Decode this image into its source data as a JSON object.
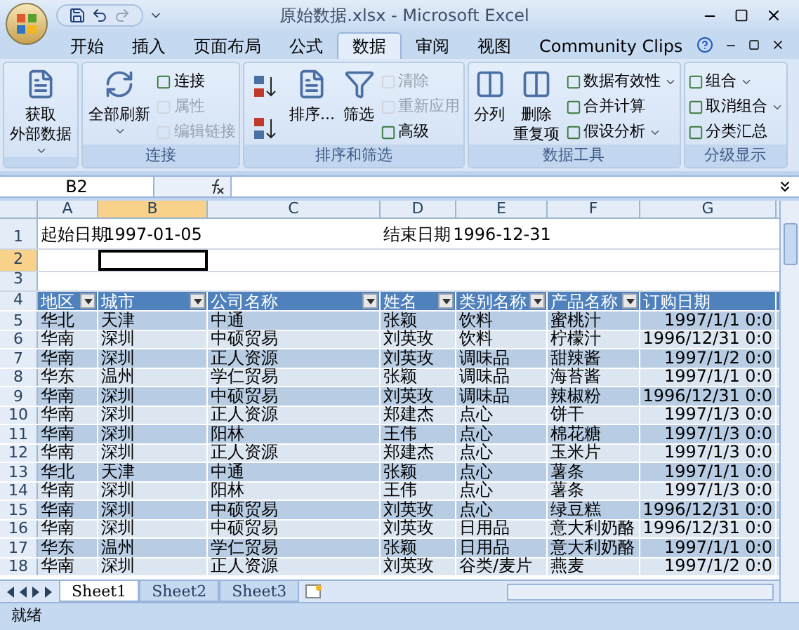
{
  "window": {
    "title": "原始数据.xlsx - Microsoft Excel"
  },
  "tabs": [
    {
      "label": "开始",
      "selected": false
    },
    {
      "label": "插入",
      "selected": false
    },
    {
      "label": "页面布局",
      "selected": false
    },
    {
      "label": "公式",
      "selected": false
    },
    {
      "label": "数据",
      "selected": true
    },
    {
      "label": "审阅",
      "selected": false
    },
    {
      "label": "视图",
      "selected": false
    },
    {
      "label": "Community Clips",
      "selected": false
    }
  ],
  "ribbon": [
    {
      "items": [
        {
          "kind": "large",
          "lines": [
            "获取",
            "外部数据"
          ],
          "dropdown": true,
          "disabled": false
        }
      ]
    },
    {
      "title": "连接",
      "items": [
        {
          "kind": "large",
          "lines": [
            "全部刷新"
          ],
          "dropdown": true,
          "disabled": false
        },
        {
          "kind": "small",
          "label": "连接",
          "dropdown": false,
          "disabled": false
        },
        {
          "kind": "small",
          "label": "属性",
          "dropdown": false,
          "disabled": true
        },
        {
          "kind": "small",
          "label": "编辑链接",
          "dropdown": false,
          "disabled": true
        }
      ]
    },
    {
      "title": "排序和筛选",
      "items": [
        {
          "kind": "sort",
          "dropdown": false,
          "disabled": false
        },
        {
          "kind": "large",
          "lines": [
            "排序..."
          ],
          "dropdown": false,
          "disabled": false
        },
        {
          "kind": "large",
          "lines": [
            "筛选"
          ],
          "dropdown": false,
          "disabled": false
        },
        {
          "kind": "small",
          "label": "清除",
          "dropdown": false,
          "disabled": true
        },
        {
          "kind": "small",
          "label": "重新应用",
          "dropdown": false,
          "disabled": true
        },
        {
          "kind": "small",
          "label": "高级",
          "dropdown": false,
          "disabled": false
        }
      ]
    },
    {
      "title": "数据工具",
      "items": [
        {
          "kind": "large",
          "lines": [
            "分列"
          ],
          "dropdown": false,
          "disabled": false
        },
        {
          "kind": "large",
          "lines": [
            "删除",
            "重复项"
          ],
          "dropdown": false,
          "disabled": false
        },
        {
          "kind": "small",
          "label": "数据有效性",
          "dropdown": true,
          "disabled": false
        },
        {
          "kind": "small",
          "label": "合并计算",
          "dropdown": false,
          "disabled": false
        },
        {
          "kind": "small",
          "label": "假设分析",
          "dropdown": true,
          "disabled": false
        }
      ]
    },
    {
      "title": "分级显示",
      "items": [
        {
          "kind": "small",
          "label": "组合",
          "dropdown": true,
          "disabled": false
        },
        {
          "kind": "small",
          "label": "取消组合",
          "dropdown": true,
          "disabled": false
        },
        {
          "kind": "small",
          "label": "分类汇总",
          "dropdown": false,
          "disabled": false
        }
      ]
    }
  ],
  "name_box": "B2",
  "columns": [
    {
      "label": "A",
      "selected": false
    },
    {
      "label": "B",
      "selected": true
    },
    {
      "label": "C",
      "selected": false
    },
    {
      "label": "D",
      "selected": false
    },
    {
      "label": "E",
      "selected": false
    },
    {
      "label": "F",
      "selected": false
    },
    {
      "label": "G",
      "selected": false
    }
  ],
  "top_rows": [
    {
      "number": "1",
      "selected": false,
      "cells": [
        "起始日期",
        "1997-01-05",
        "",
        "结束日期",
        "1996-12-31",
        "",
        ""
      ]
    },
    {
      "number": "2",
      "selected": true,
      "cells": [
        "",
        "",
        "",
        "",
        "",
        "",
        ""
      ]
    },
    {
      "number": "3",
      "selected": false,
      "cells": [
        "",
        "",
        "",
        "",
        "",
        "",
        ""
      ]
    }
  ],
  "table": {
    "row_number": "4",
    "columns": [
      "地区",
      "城市",
      "公司名称",
      "姓名",
      "类别名称",
      "产品名称",
      "订购日期"
    ],
    "rows": [
      {
        "number": "5",
        "cells": [
          "华北",
          "天津",
          "中通",
          "张颖",
          "饮料",
          "蜜桃汁",
          "1997/1/1 0:0"
        ]
      },
      {
        "number": "6",
        "cells": [
          "华南",
          "深圳",
          "中硕贸易",
          "刘英玫",
          "饮料",
          "柠檬汁",
          "1996/12/31 0:0"
        ]
      },
      {
        "number": "7",
        "cells": [
          "华南",
          "深圳",
          "正人资源",
          "刘英玫",
          "调味品",
          "甜辣酱",
          "1997/1/2 0:0"
        ]
      },
      {
        "number": "8",
        "cells": [
          "华东",
          "温州",
          "学仁贸易",
          "张颖",
          "调味品",
          "海苔酱",
          "1997/1/1 0:0"
        ]
      },
      {
        "number": "9",
        "cells": [
          "华南",
          "深圳",
          "中硕贸易",
          "刘英玫",
          "调味品",
          "辣椒粉",
          "1996/12/31 0:0"
        ]
      },
      {
        "number": "10",
        "cells": [
          "华南",
          "深圳",
          "正人资源",
          "郑建杰",
          "点心",
          "饼干",
          "1997/1/3 0:0"
        ]
      },
      {
        "number": "11",
        "cells": [
          "华南",
          "深圳",
          "阳林",
          "王伟",
          "点心",
          "棉花糖",
          "1997/1/3 0:0"
        ]
      },
      {
        "number": "12",
        "cells": [
          "华南",
          "深圳",
          "正人资源",
          "郑建杰",
          "点心",
          "玉米片",
          "1997/1/3 0:0"
        ]
      },
      {
        "number": "13",
        "cells": [
          "华北",
          "天津",
          "中通",
          "张颖",
          "点心",
          "薯条",
          "1997/1/1 0:0"
        ]
      },
      {
        "number": "14",
        "cells": [
          "华南",
          "深圳",
          "阳林",
          "王伟",
          "点心",
          "薯条",
          "1997/1/3 0:0"
        ]
      },
      {
        "number": "15",
        "cells": [
          "华南",
          "深圳",
          "中硕贸易",
          "刘英玫",
          "点心",
          "绿豆糕",
          "1996/12/31 0:0"
        ]
      },
      {
        "number": "16",
        "cells": [
          "华南",
          "深圳",
          "中硕贸易",
          "刘英玫",
          "日用品",
          "意大利奶酪",
          "1996/12/31 0:0"
        ]
      },
      {
        "number": "17",
        "cells": [
          "华东",
          "温州",
          "学仁贸易",
          "张颖",
          "日用品",
          "意大利奶酪",
          "1997/1/1 0:0"
        ]
      },
      {
        "number": "18",
        "cells": [
          "华南",
          "深圳",
          "正人资源",
          "刘英玫",
          "谷类/麦片",
          "燕麦",
          "1997/1/2 0:0"
        ]
      }
    ]
  },
  "sheets": [
    {
      "label": "Sheet1",
      "selected": true
    },
    {
      "label": "Sheet2",
      "selected": false
    },
    {
      "label": "Sheet3",
      "selected": false
    }
  ],
  "status_bar": "就绪"
}
